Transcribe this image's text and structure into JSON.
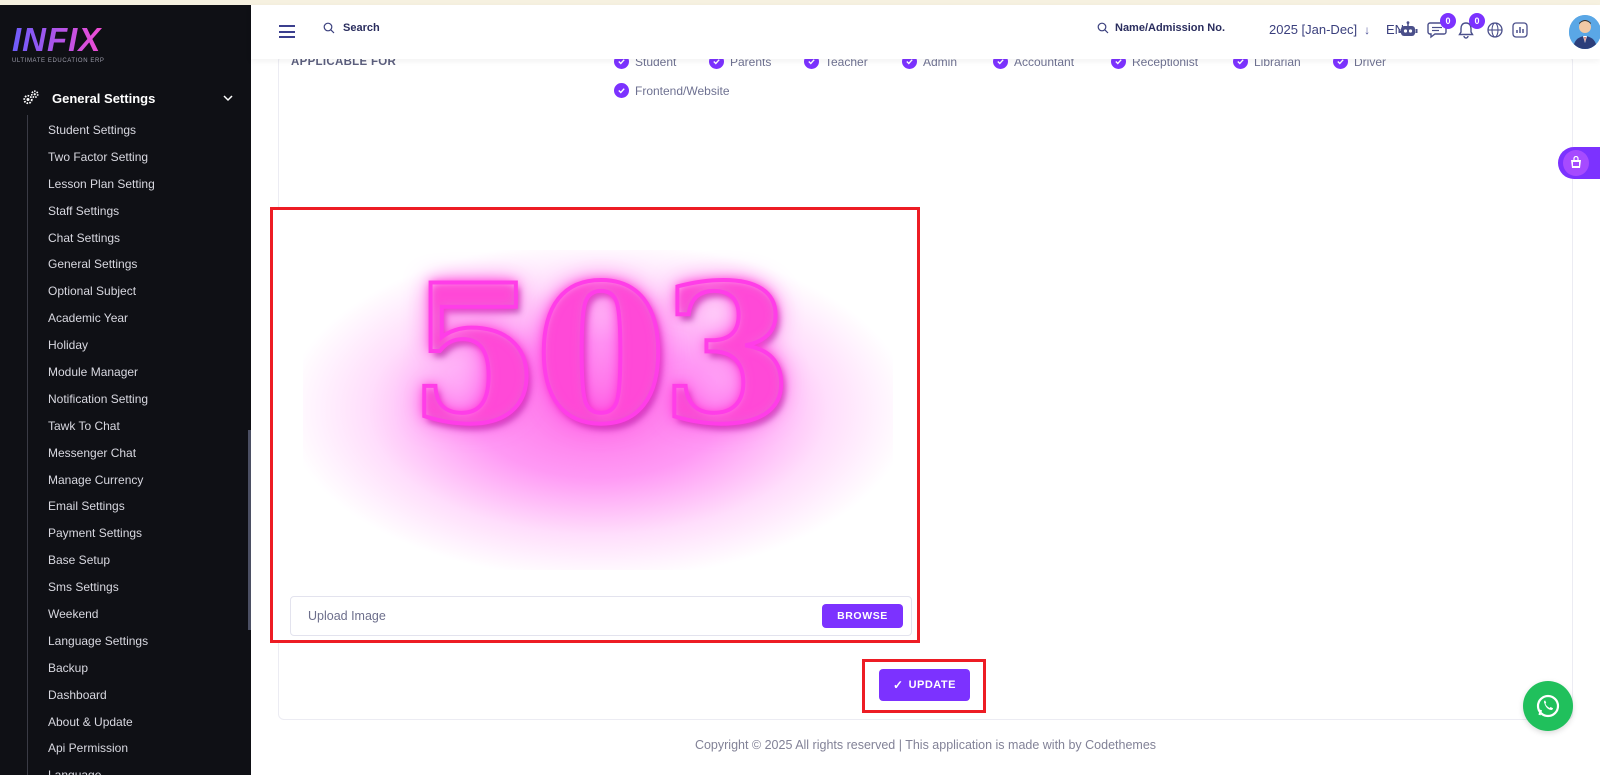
{
  "brand": {
    "logo": "INFIX",
    "tagline": "ULTIMATE EDUCATION ERP"
  },
  "sidebar": {
    "section_label": "General Settings",
    "items": [
      "Student Settings",
      "Two Factor Setting",
      "Lesson Plan Setting",
      "Staff Settings",
      "Chat Settings",
      "General Settings",
      "Optional Subject",
      "Academic Year",
      "Holiday",
      "Module Manager",
      "Notification Setting",
      "Tawk To Chat",
      "Messenger Chat",
      "Manage Currency",
      "Email Settings",
      "Payment Settings",
      "Base Setup",
      "Sms Settings",
      "Weekend",
      "Language Settings",
      "Backup",
      "Dashboard",
      "About & Update",
      "Api Permission",
      "Language"
    ]
  },
  "topbar": {
    "search_label": "Search",
    "admission_search_label": "Name/Admission No.",
    "year": "2025 [Jan-Dec]",
    "language": "EN",
    "chat_badge": "0",
    "notification_badge": "0"
  },
  "applicable": {
    "label": "APPLICABLE FOR",
    "options": [
      "Student",
      "Parents",
      "Teacher",
      "Admin",
      "Accountant",
      "Receptionist",
      "Librarian",
      "Driver",
      "Frontend/Website"
    ]
  },
  "preview": {
    "text": "503"
  },
  "upload": {
    "placeholder": "Upload Image",
    "browse_label": "BROWSE"
  },
  "update_label": "UPDATE",
  "footer": "Copyright © 2025 All rights reserved | This application is made with by Codethemes",
  "colors": {
    "accent": "#7c32ff",
    "highlight": "#ed1c24",
    "sidebar_bg": "#0f1015",
    "whatsapp": "#20c05c"
  }
}
